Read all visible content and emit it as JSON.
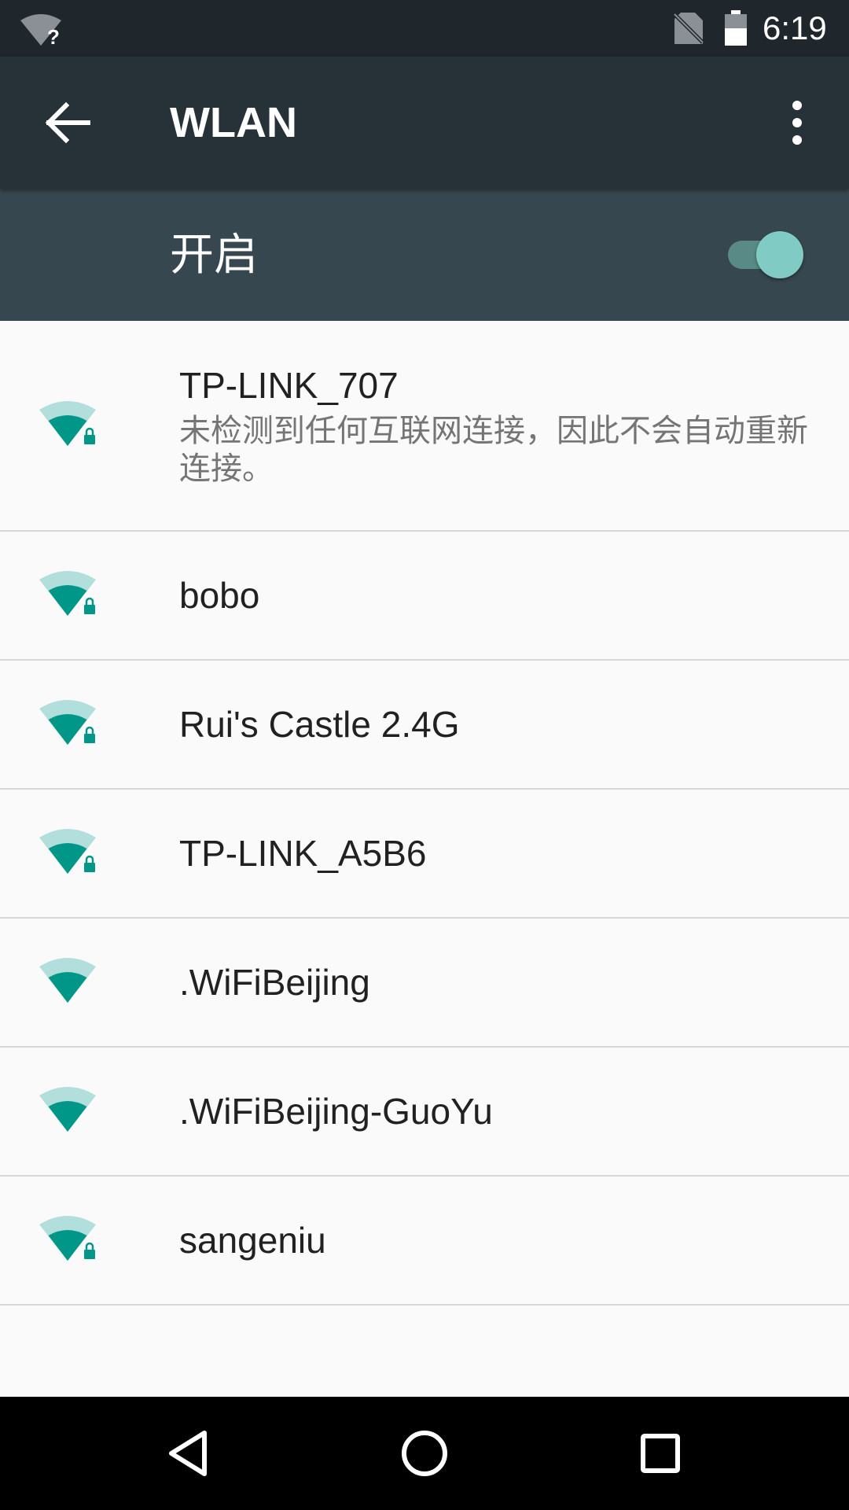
{
  "colors": {
    "status_bar": "#1f272c",
    "toolbar": "#263238",
    "switch_bar": "#37474f",
    "accent": "#009688",
    "accent_light": "#b2dfdb",
    "toggle_thumb": "#80cbc4"
  },
  "status_bar": {
    "time": "6:19",
    "icons": [
      "wifi-unknown-icon",
      "no-sim-icon",
      "battery-icon"
    ]
  },
  "toolbar": {
    "title": "WLAN",
    "back_icon": "arrow-back-icon",
    "menu_icon": "more-vert-icon"
  },
  "master_switch": {
    "label": "开启",
    "state": "on"
  },
  "networks": [
    {
      "ssid": "TP-LINK_707",
      "summary": "未检测到任何互联网连接，因此不会自动重新连接。",
      "secured": true,
      "signal_level": 2
    },
    {
      "ssid": "bobo",
      "secured": true,
      "signal_level": 2
    },
    {
      "ssid": "Rui's Castle 2.4G",
      "secured": true,
      "signal_level": 2
    },
    {
      "ssid": "TP-LINK_A5B6",
      "secured": true,
      "signal_level": 2
    },
    {
      "ssid": ".WiFiBeijing",
      "secured": false,
      "signal_level": 2
    },
    {
      "ssid": ".WiFiBeijing-GuoYu",
      "secured": false,
      "signal_level": 2
    },
    {
      "ssid": "sangeniu",
      "secured": true,
      "signal_level": 2
    }
  ],
  "nav_bar": {
    "buttons": [
      "back-triangle-icon",
      "home-circle-icon",
      "recents-square-icon"
    ]
  }
}
